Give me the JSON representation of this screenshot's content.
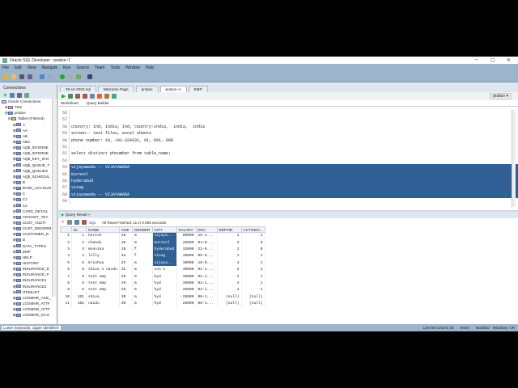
{
  "window": {
    "title": "Oracle SQL Developer : pratice~1",
    "minimize": "–",
    "maximize": "▢",
    "close": "✕"
  },
  "menu": [
    "File",
    "Edit",
    "View",
    "Navigate",
    "Run",
    "Source",
    "Team",
    "Tools",
    "Window",
    "Help"
  ],
  "connections": {
    "title": "Connections",
    "root": "Oracle Connections",
    "items": [
      "TNS",
      "pratice"
    ],
    "tables_label": "Tables (Filtered)",
    "tables": [
      "A",
      "AA",
      "AB",
      "ABC",
      "AQ$_INTERNE",
      "AQ$_INTERNE",
      "AQ$_KEY_SHA",
      "AQ$_QUEUE_T",
      "AQ$_QUEUES",
      "AQ$_SCHEDUL",
      "B",
      "BANK_ACCOUN",
      "C",
      "C1",
      "C2",
      "CARD_DETAIL",
      "CRICKET_TEA",
      "CUST_AUDIT",
      "CUST_DENORM",
      "CUSTOMER_D",
      "D",
      "DATA_TYPES",
      "EMP",
      "HELP",
      "HISTORY",
      "INSURANCE_D",
      "INSURANCE_P",
      "INSURANCE1",
      "INSURANCE2",
      "ITEMLIST",
      "LOGMNR_AGE_",
      "LOGMNR_ATTF",
      "LOGMNR_ATTF",
      "LOGMNR_GCO"
    ]
  },
  "tabs": [
    "29-12-2022.sql",
    "Welcome Page",
    "pratice",
    "pratice~1",
    "EMP"
  ],
  "connection_selector": "pratice",
  "worksheet_tabs": [
    "Worksheet",
    "Query Builder"
  ],
  "editor": {
    "lines": [
      {
        "n": "56",
        "t": ""
      },
      {
        "n": "57",
        "t": ""
      },
      {
        "n": "58",
        "t": "country: ind, india, Ind, country-india,  india,  india"
      },
      {
        "n": "59",
        "t": "screen-- text files, excel sheets"
      },
      {
        "n": "60",
        "t": "phone number: 10, +91-324332, 91, 091, 099"
      },
      {
        "n": "61",
        "t": ""
      },
      {
        "n": "62",
        "t": "select distinct phnumber from table_name;"
      },
      {
        "n": "63",
        "t": ""
      },
      {
        "n": "64",
        "t": "vijayawada -- VIJAYAWADA",
        "sel": true
      },
      {
        "n": "65",
        "t": "Kurnool",
        "sel": true
      },
      {
        "n": "66",
        "t": "hyderabad",
        "sel": true
      },
      {
        "n": "67",
        "t": "vizag",
        "sel": true
      },
      {
        "n": "68",
        "t": "vijayawada -- VIJAYAWADA",
        "sel": true
      },
      {
        "n": "69",
        "t": ""
      }
    ]
  },
  "result": {
    "tab": "Query Result",
    "sql_label": "SQL",
    "message": "All Rows Fetched: 11 in 0.005 seconds",
    "columns": [
      "ID",
      "NAME",
      "AGE",
      "GENDER",
      "CITY",
      "SALARY",
      "DOJ",
      "DEPTID",
      "ACTIVEO..."
    ],
    "rows": [
      [
        "1",
        "1",
        "harish",
        "28",
        "m",
        "vijaya...",
        "80000",
        "15-1...",
        "1",
        "1"
      ],
      [
        "2",
        "2",
        "chandu",
        "35",
        "m",
        "Kurnool",
        "32000",
        "04-0...",
        "3",
        "0"
      ],
      [
        "3",
        "3",
        "mounika",
        "28",
        "f",
        "hyderabad",
        "32000",
        "22-0...",
        "2",
        "0"
      ],
      [
        "4",
        "4",
        "lilly",
        "45",
        "f",
        "vizag",
        "40000",
        "06-0...",
        "1",
        "1"
      ],
      [
        "5",
        "5",
        "krishna",
        "22",
        "m",
        "vijaya...",
        "10000",
        "18-0...",
        "4",
        "1"
      ],
      [
        "6",
        "6",
        "shiva n naidu",
        "32",
        "m",
        "con's",
        "40000",
        "01-1...",
        "2",
        "1"
      ],
      [
        "7",
        "6",
        "test emp",
        "29",
        "m",
        "hyd",
        "36000",
        "02-1...",
        "2",
        "1"
      ],
      [
        "8",
        "5",
        "test emp",
        "29",
        "m",
        "hyd",
        "36000",
        "02-1...",
        "4",
        "1"
      ],
      [
        "9",
        "5",
        "test emp",
        "29",
        "m",
        "hyd",
        "36000",
        "03-1...",
        "4",
        "1"
      ],
      [
        "10",
        "101",
        "shiva",
        "30",
        "m",
        "hyd",
        "-25000",
        "08-1...",
        "(null)",
        "(null)"
      ],
      [
        "11",
        "102",
        "naidu",
        "30",
        "m",
        "hyd",
        "25000",
        "08-1...",
        "(null)",
        "(null)"
      ]
    ]
  },
  "status": {
    "left": "Lower Keywords, Upper Identifiers",
    "position": "Line 68 Column 25",
    "mode": "Insert",
    "modified": "Modified",
    "eol": "Windows: CR"
  }
}
